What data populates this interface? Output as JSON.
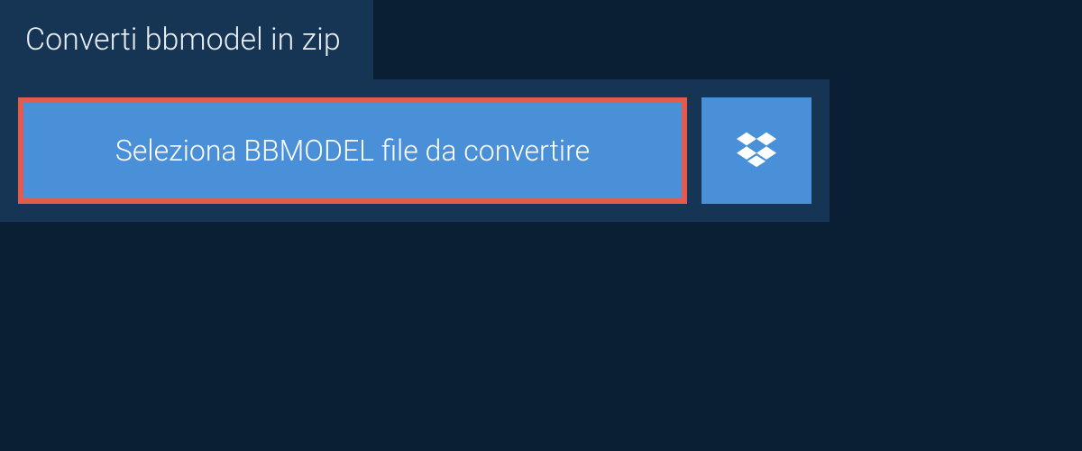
{
  "tab": {
    "label": "Converti bbmodel in zip"
  },
  "actions": {
    "select_file_label": "Seleziona BBMODEL file da convertire"
  },
  "colors": {
    "background": "#0a1f33",
    "panel": "#163453",
    "button": "#4a90d9",
    "highlight_border": "#e35a4f",
    "text_light": "#e8eef4",
    "text_white": "#ffffff"
  }
}
